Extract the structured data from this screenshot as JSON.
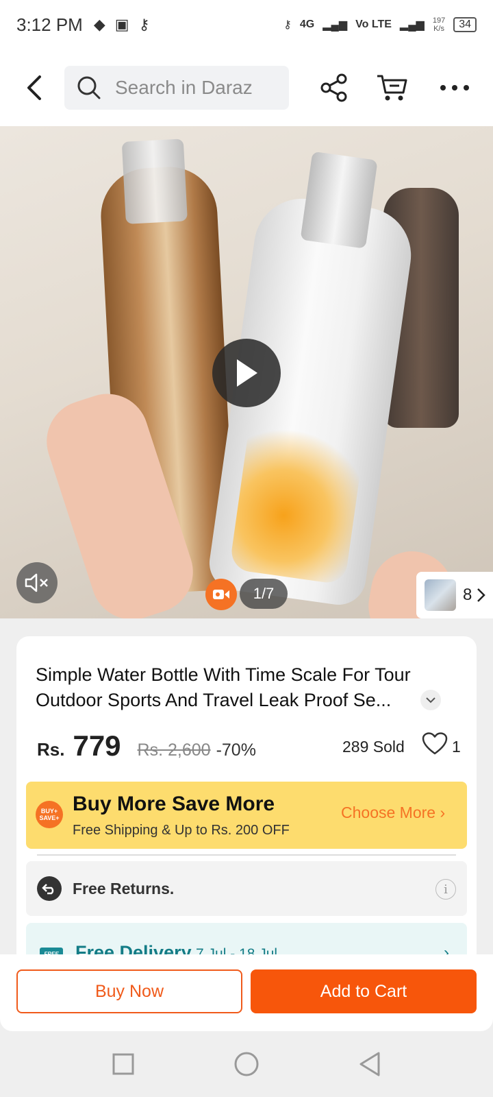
{
  "status_bar": {
    "time": "3:12 PM",
    "network": "4G",
    "volte": "Vo LTE",
    "speed_value": "197",
    "speed_unit": "K/s",
    "battery": "34"
  },
  "header": {
    "search_placeholder": "Search in Daraz",
    "icons": [
      "back-icon",
      "search-icon",
      "share-icon",
      "cart-icon",
      "more-icon"
    ]
  },
  "media": {
    "counter": "1/7",
    "gallery_count": "8"
  },
  "product": {
    "title": "Simple Water Bottle With Time Scale For Tour Outdoor Sports And Travel Leak Proof Se...",
    "currency": "Rs.",
    "price": "779",
    "original_price": "Rs. 2,600",
    "discount": "-70%",
    "sold": "289 Sold",
    "likes": "1"
  },
  "promo": {
    "badge": "BUY+ SAVE+",
    "title": "Buy More Save More",
    "subtitle": "Free Shipping & Up to Rs. 200 OFF",
    "cta": "Choose More"
  },
  "returns": {
    "label": "Free Returns.",
    "info": "i"
  },
  "delivery": {
    "badge": "FREE",
    "label": "Free Delivery",
    "dates": "7 Jul - 18 Jul"
  },
  "actions": {
    "buy_now": "Buy Now",
    "add_to_cart": "Add to Cart"
  },
  "colors": {
    "accent": "#f57224",
    "cta": "#f7560b",
    "promo_bg": "#fddc6e",
    "delivery_text": "#137c86"
  }
}
